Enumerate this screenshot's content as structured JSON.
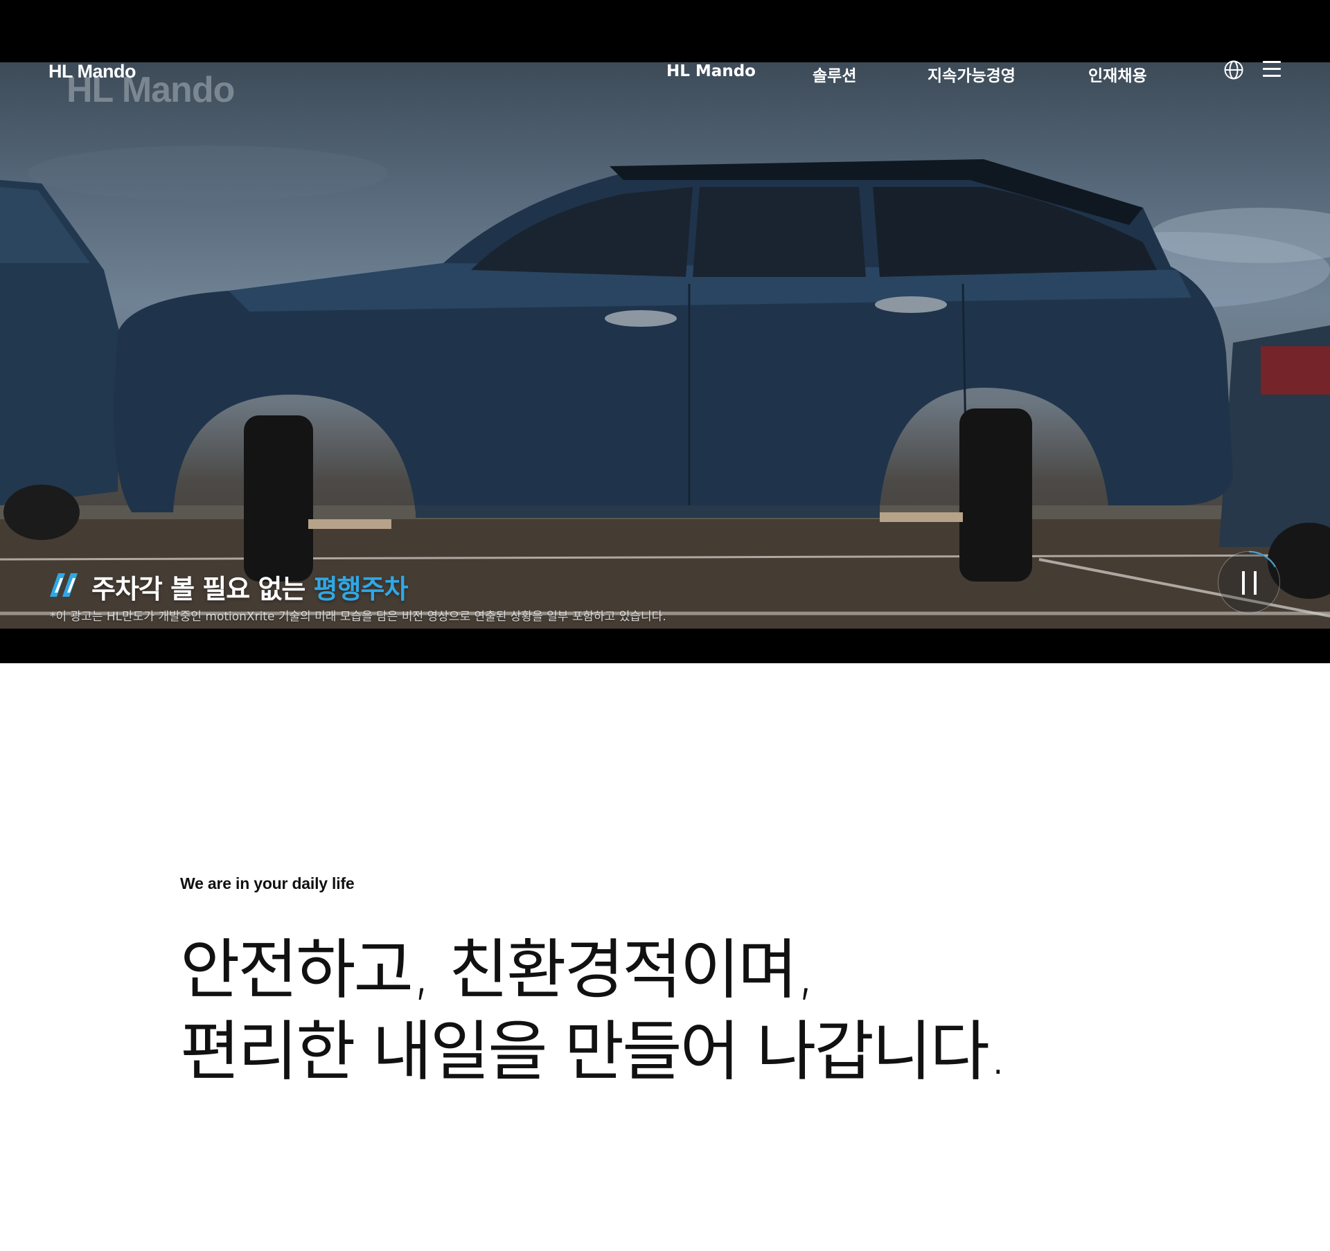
{
  "header": {
    "logo": "HL Mando",
    "nav": [
      {
        "label": "HL Mando"
      },
      {
        "label": "솔루션"
      },
      {
        "label": "지속가능경영"
      },
      {
        "label": "인재채용"
      }
    ],
    "icons": {
      "language": "globe-icon",
      "menu": "hamburger-menu-icon"
    }
  },
  "hero": {
    "video_watermark": "HL Mando",
    "caption_prefix": "주차각 볼 필요 없는 ",
    "caption_highlight": "평행주차",
    "disclaimer": "*이 광고는 HL만도가 개발중인 motionXrite 기술의 미래 모습을 담은 비전 영상으로 연출된 상황을 일부 포함하고 있습니다.",
    "player_state": "playing",
    "control_icon": "pause-icon",
    "accent_color": "#2fa8e6"
  },
  "intro": {
    "eyebrow": "We are in your daily life",
    "headline_line1": "안전하고, 친환경적이며,",
    "headline_line2": "편리한 내일을 만들어 나갑니다."
  }
}
